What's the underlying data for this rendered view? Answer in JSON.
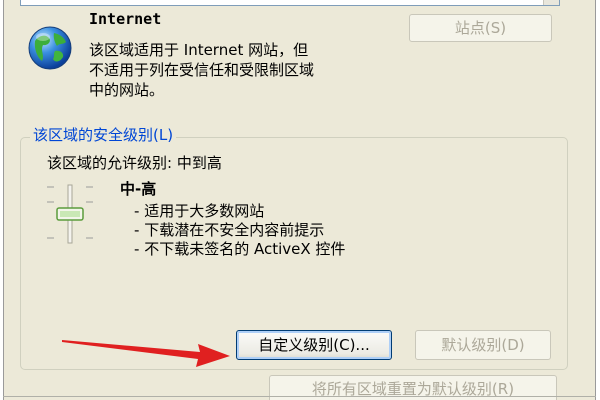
{
  "zone": {
    "name": "Internet",
    "description_lines": [
      "该区域适用于 Internet 网站，但",
      "不适用于列在受信任和受限制区域",
      "中的网站。"
    ],
    "icon": "globe-icon"
  },
  "buttons": {
    "sites": "站点(S)",
    "custom_level": "自定义级别(C)...",
    "default_level": "默认级别(D)",
    "reset_all": "将所有区域重置为默认级别(R)"
  },
  "security_level": {
    "group_label": "该区域的安全级别(L)",
    "allowed_levels": "该区域的允许级别: 中到高",
    "current_level": "中-高",
    "slider_level": "中-高",
    "details": [
      "适用于大多数网站",
      "下载潜在不安全内容前提示",
      "不下载未签名的 ActiveX 控件"
    ]
  },
  "colors": {
    "group_label": "#0046d5",
    "dialog_bg": "#ece9d8",
    "arrow": "#e02020"
  }
}
